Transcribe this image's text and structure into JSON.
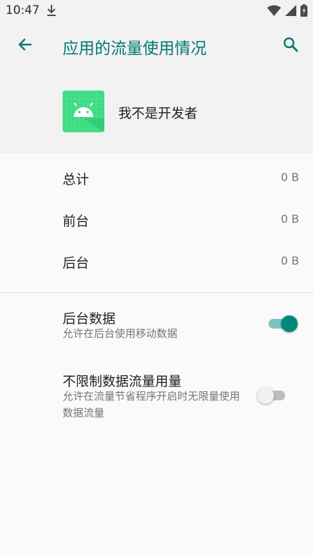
{
  "status_bar": {
    "time": "10:47",
    "icons": [
      "download-icon",
      "wifi-icon",
      "signal-icon",
      "battery-icon"
    ]
  },
  "app_bar": {
    "title": "应用的流量使用情况",
    "back_icon": "arrow-back-icon",
    "search_icon": "search-icon",
    "accent_color": "#00796b"
  },
  "app_header": {
    "name": "我不是开发者",
    "icon": "android-icon"
  },
  "usage": [
    {
      "label": "总计",
      "value": "0 B"
    },
    {
      "label": "前台",
      "value": "0 B"
    },
    {
      "label": "后台",
      "value": "0 B"
    }
  ],
  "preferences": [
    {
      "title": "后台数据",
      "summary": "允许在后台使用移动数据",
      "enabled": true
    },
    {
      "title": "不限制数据流量用量",
      "summary": "允许在流量节省程序开启时无限量使用数据流量",
      "enabled": false
    }
  ]
}
